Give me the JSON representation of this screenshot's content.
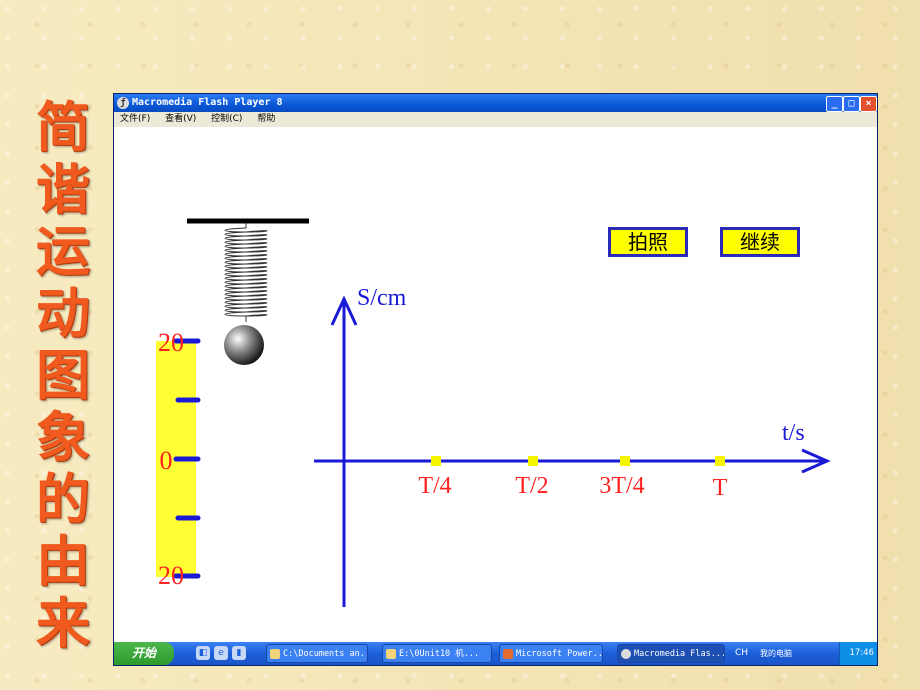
{
  "slide": {
    "title_chars": [
      "简",
      "谐",
      "运",
      "动",
      "图",
      "象",
      "的",
      "由",
      "来"
    ]
  },
  "window": {
    "title": "Macromedia Flash Player 8",
    "icon": "flash-player-icon",
    "controls": {
      "minimize": "_",
      "maximize": "□",
      "close": "×"
    },
    "menu": [
      "文件(F)",
      "查看(V)",
      "控制(C)",
      "帮助"
    ]
  },
  "flash": {
    "buttons": {
      "photo": "拍照",
      "continue": "继续"
    },
    "ruler": {
      "top_label": "20",
      "mid_label": "0",
      "bottom_label": "20"
    },
    "axes": {
      "y_label": "S/cm",
      "x_label": "t/s",
      "x_ticks": [
        "T/4",
        "T/2",
        "3T/4",
        "T"
      ]
    },
    "colors": {
      "axis": "#1a1ad6",
      "ruler": "#ffff33",
      "button_fill": "#ffff00",
      "button_border": "#2b2bb5",
      "tick_marker": "#f5f500",
      "label": "#ff2020"
    }
  },
  "taskbar": {
    "start": "开始",
    "tasks": [
      "C:\\Documents an...",
      "E:\\0Unit10  机...",
      "Microsoft Power...",
      "Macromedia Flas..."
    ],
    "ime": "CH",
    "my_computer": "我的电脑",
    "clock": "17:46"
  }
}
